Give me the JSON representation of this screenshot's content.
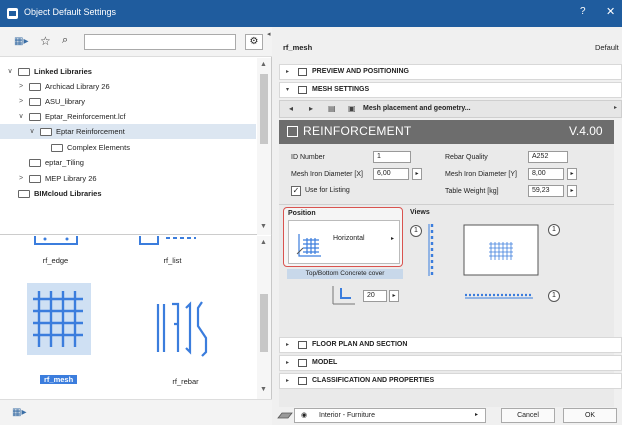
{
  "window": {
    "title": "Object Default Settings",
    "help": "?",
    "close": "✕"
  },
  "left": {
    "search_value": "",
    "tree": [
      {
        "label": "Linked Libraries",
        "level": 0,
        "arrow": "∨",
        "bold": true,
        "selected": false
      },
      {
        "label": "Archicad Library 26",
        "level": 1,
        "arrow": ">",
        "bold": false,
        "selected": false
      },
      {
        "label": "ASU_library",
        "level": 1,
        "arrow": ">",
        "bold": false,
        "selected": false
      },
      {
        "label": "Eptar_Reinforcement.lcf",
        "level": 1,
        "arrow": "∨",
        "bold": false,
        "selected": false
      },
      {
        "label": "Eptar Reinforcement",
        "level": 2,
        "arrow": "∨",
        "bold": false,
        "selected": true
      },
      {
        "label": "Complex Elements",
        "level": 3,
        "arrow": "",
        "bold": false,
        "selected": false
      },
      {
        "label": "eptar_Tiling",
        "level": 1,
        "arrow": "",
        "bold": false,
        "selected": false
      },
      {
        "label": "MEP Library 26",
        "level": 1,
        "arrow": ">",
        "bold": false,
        "selected": false
      },
      {
        "label": "BIMcloud Libraries",
        "level": 0,
        "arrow": "",
        "bold": true,
        "selected": false
      }
    ],
    "gallery": [
      {
        "label": "rf_edge"
      },
      {
        "label": "rf_list"
      },
      {
        "label": "rf_mesh",
        "selected": true
      },
      {
        "label": "rf_rebar"
      }
    ],
    "partial_text": "ight"
  },
  "right": {
    "object_name": "rf_mesh",
    "default_label": "Default",
    "sections_top": [
      {
        "label": "PREVIEW AND POSITIONING",
        "tri": "▸"
      },
      {
        "label": "MESH SETTINGS",
        "tri": "▾"
      }
    ],
    "subpage": "Mesh placement and geometry...",
    "panel": {
      "title": "REINFORCEMENT",
      "version": "V.4.00",
      "id_label": "ID Number",
      "id_value": "1",
      "rebar_quality_label": "Rebar Quality",
      "rebar_quality_value": "A252",
      "mesh_x_label": "Mesh Iron Diameter [X]",
      "mesh_x_value": "6,00",
      "mesh_y_label": "Mesh Iron Diameter [Y]",
      "mesh_y_value": "8,00",
      "use_listing_label": "Use for Listing",
      "table_weight_label": "Table Weight [kg]",
      "table_weight_value": "59,23",
      "position_label": "Position",
      "position_value": "Horizontal",
      "position_caption": "Top/Bottom Concrete cover",
      "cover_value": "20",
      "views_label": "Views",
      "circle_label": "1"
    },
    "sections_bottom": [
      {
        "label": "FLOOR PLAN AND SECTION"
      },
      {
        "label": "MODEL"
      },
      {
        "label": "CLASSIFICATION AND PROPERTIES"
      }
    ],
    "footer": {
      "layer": "Interior - Furniture",
      "cancel": "Cancel",
      "ok": "OK"
    }
  },
  "colors": {
    "titlebar": "#1f5c9e",
    "accent_blue": "#3b7ddd",
    "highlight_red": "#d9534f"
  }
}
